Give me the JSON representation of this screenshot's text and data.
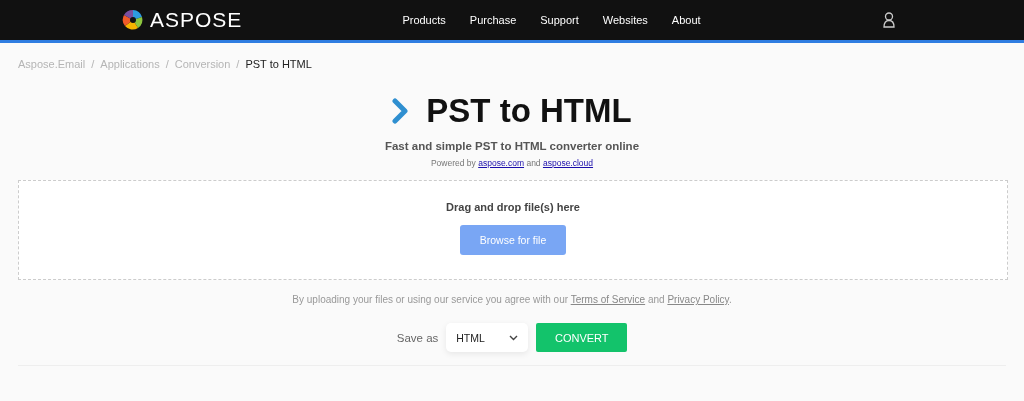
{
  "header": {
    "logo_text": "ASPOSE",
    "nav": [
      {
        "label": "Products"
      },
      {
        "label": "Purchase"
      },
      {
        "label": "Support"
      },
      {
        "label": "Websites"
      },
      {
        "label": "About"
      }
    ]
  },
  "breadcrumbs": [
    {
      "label": "Aspose.Email",
      "separator": "/",
      "selected": false
    },
    {
      "label": "Applications",
      "separator": "/",
      "selected": false
    },
    {
      "label": "Conversion",
      "separator": "/",
      "selected": false
    },
    {
      "label": "PST to HTML",
      "selected": true
    }
  ],
  "title": "PST to HTML",
  "subtitle": "Fast and simple PST to HTML converter online",
  "powered_by": [
    {
      "kind": "text",
      "text": "Powered by "
    },
    {
      "kind": "link",
      "text": "aspose.com"
    },
    {
      "kind": "text",
      "text": " and "
    },
    {
      "kind": "link",
      "text": "aspose.cloud"
    }
  ],
  "dropzone": {
    "prompt": "Drag and drop file(s) here",
    "button": "Browse for file"
  },
  "terms": [
    {
      "kind": "text",
      "text": "By uploading your files or using our service you agree with our "
    },
    {
      "kind": "link",
      "text": "Terms of Service"
    },
    {
      "kind": "text",
      "text": " and "
    },
    {
      "kind": "link",
      "text": "Privacy Policy"
    },
    {
      "kind": "text",
      "text": "."
    }
  ],
  "save_as": {
    "label": "Save as",
    "value": "HTML",
    "button": "CONVERT"
  }
}
